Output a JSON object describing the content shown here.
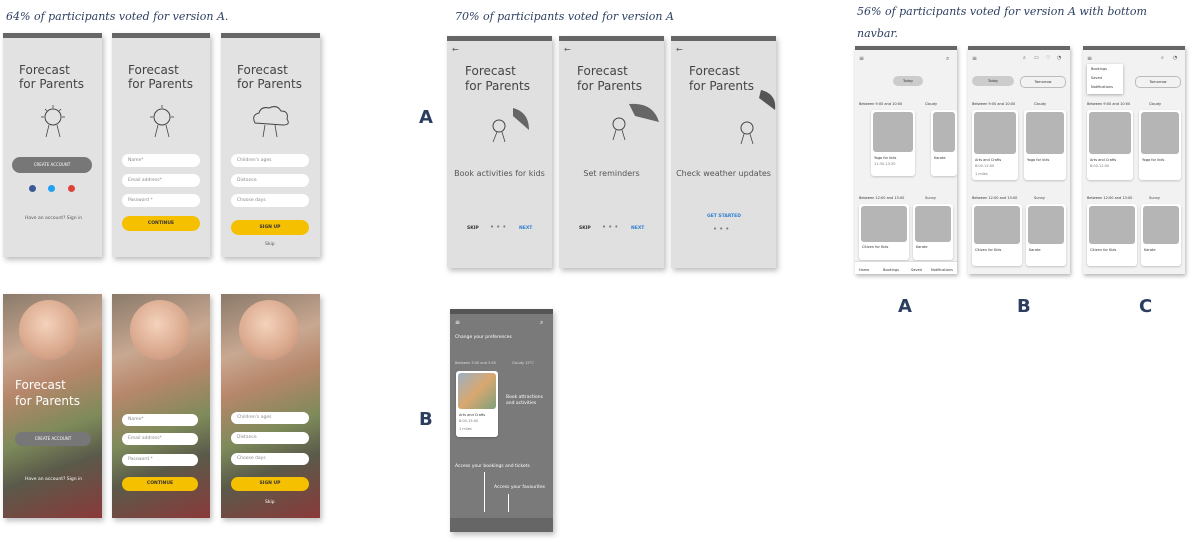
{
  "captions": {
    "row1": "64% of participants voted for version A.",
    "row2": "70% of participants voted for version A",
    "row3_line1": "56% of participants voted for version A with bottom",
    "row3_line2": "navbar."
  },
  "variant_labels": {
    "A": "A",
    "B": "B",
    "nav_a": "A",
    "nav_b": "B",
    "nav_c": "C"
  },
  "app": {
    "title_line1": "Forecast",
    "title_line2": "for Parents"
  },
  "signup": {
    "create_account": "CREATE ACCOUNT",
    "have_account": "Have an account? Sign in",
    "name_placeholder": "Name*",
    "email_placeholder": "Email address*",
    "password_placeholder": "Password *",
    "continue": "CONTINUE",
    "children_ages": "Children's ages",
    "distance": "Distance",
    "choose_days": "Choose days",
    "sign_up": "SIGN UP",
    "skip": "Skip"
  },
  "onboarding": {
    "screen1": "Book activities for kids",
    "screen2": "Set reminders",
    "screen3": "Check weather updates",
    "skip": "SKIP",
    "next": "NEXT",
    "get_started": "GET STARTED"
  },
  "onboarding_b": {
    "change_prefs": "Change your preferences",
    "book_line1": "Book attractions",
    "book_line2": "and activities",
    "access_bookings": "Access your bookings and tickets",
    "access_favourites": "Access your favourites",
    "slot1": "Between 3:00 and 3:45",
    "slot1_weather": "Cloudy 15°C",
    "card_title": "Arts and Crafts",
    "card_time": "8:00-15:00",
    "card_meta": "1 miles"
  },
  "navbar": {
    "today": "Today",
    "tomorrow": "Tomorrow",
    "slot1": "Between 9:00 and 10:00",
    "slot1_weather": "Cloudy",
    "slot2": "Between 12:00 and 13:00",
    "slot2_weather": "Sunny",
    "cards": {
      "yoga": "Yoga for kids",
      "yoga_time": "11:30-13:30",
      "karate": "Karate",
      "arts": "Arts and Crafts",
      "arts_time": "8:00-12:00",
      "citizen": "Citizen for Kids",
      "distance": "1 miles"
    },
    "menu_items": [
      "Bookings",
      "Saved",
      "Notifications"
    ],
    "tabs": [
      "Home",
      "Bookings",
      "Saved",
      "Notifications"
    ]
  }
}
